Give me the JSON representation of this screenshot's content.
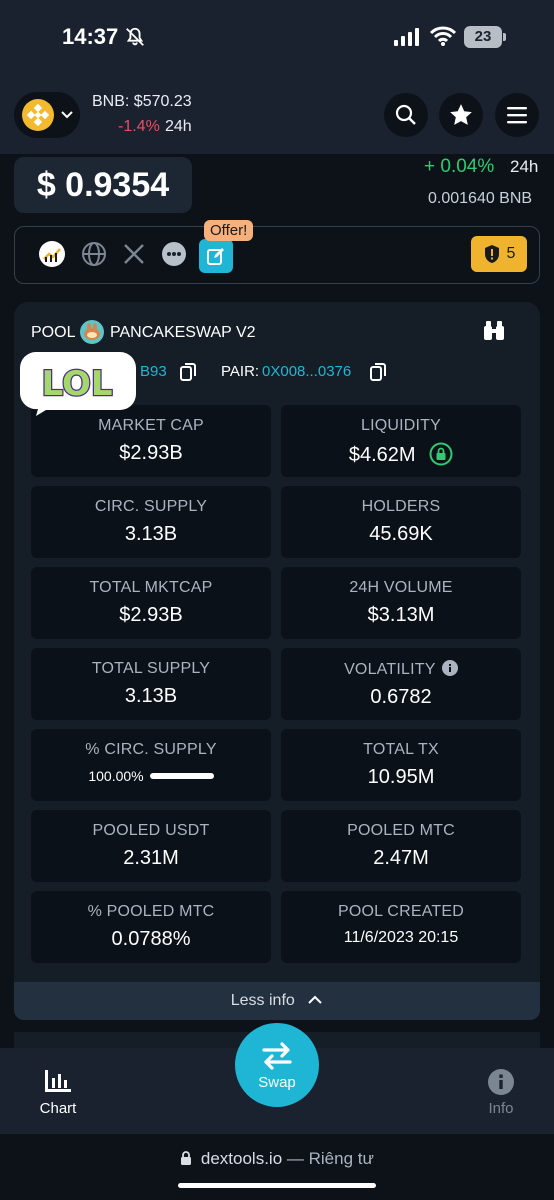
{
  "status_bar": {
    "time": "14:37",
    "battery": "23"
  },
  "header": {
    "bnb_price": "BNB: $570.23",
    "bnb_change": "-1.4%",
    "bnb_period": "24h"
  },
  "price": {
    "usd": "$ 0.9354",
    "change_pct": "+ 0.04%",
    "change_period": "24h",
    "bnb_value": "0.001640  BNB"
  },
  "social": {
    "offer_label": "Offer!",
    "audit_count": "5"
  },
  "pool": {
    "label": "POOL",
    "name": "PANCAKESWAP V2",
    "token_addr_tail": "B93",
    "pair_label": "PAIR:",
    "pair_addr": "0X008...0376",
    "stats": [
      {
        "label": "MARKET CAP",
        "value": "$2.93B"
      },
      {
        "label": "LIQUIDITY",
        "value": "$4.62M"
      },
      {
        "label": "CIRC. SUPPLY",
        "value": "3.13B"
      },
      {
        "label": "HOLDERS",
        "value": "45.69K"
      },
      {
        "label": "TOTAL MKTCAP",
        "value": "$2.93B"
      },
      {
        "label": "24H VOLUME",
        "value": "$3.13M"
      },
      {
        "label": "TOTAL SUPPLY",
        "value": "3.13B"
      },
      {
        "label": "VOLATILITY",
        "value": "0.6782"
      },
      {
        "label": "% CIRC. SUPPLY",
        "value": "100.00%"
      },
      {
        "label": "TOTAL TX",
        "value": "10.95M"
      },
      {
        "label": "POOLED USDT",
        "value": "2.31M"
      },
      {
        "label": "POOLED MTC",
        "value": "2.47M"
      },
      {
        "label": "% POOLED MTC",
        "value": "0.0788%"
      },
      {
        "label": "POOL CREATED",
        "value": "11/6/2023 20:15"
      }
    ],
    "circ_supply_fraction": 1.0,
    "less_info": "Less info"
  },
  "sticker": {
    "text": "LOL"
  },
  "nav": {
    "chart": "Chart",
    "swap": "Swap",
    "info": "Info"
  },
  "browser": {
    "domain": "dextools.io",
    "suffix": "— Riêng tư"
  }
}
